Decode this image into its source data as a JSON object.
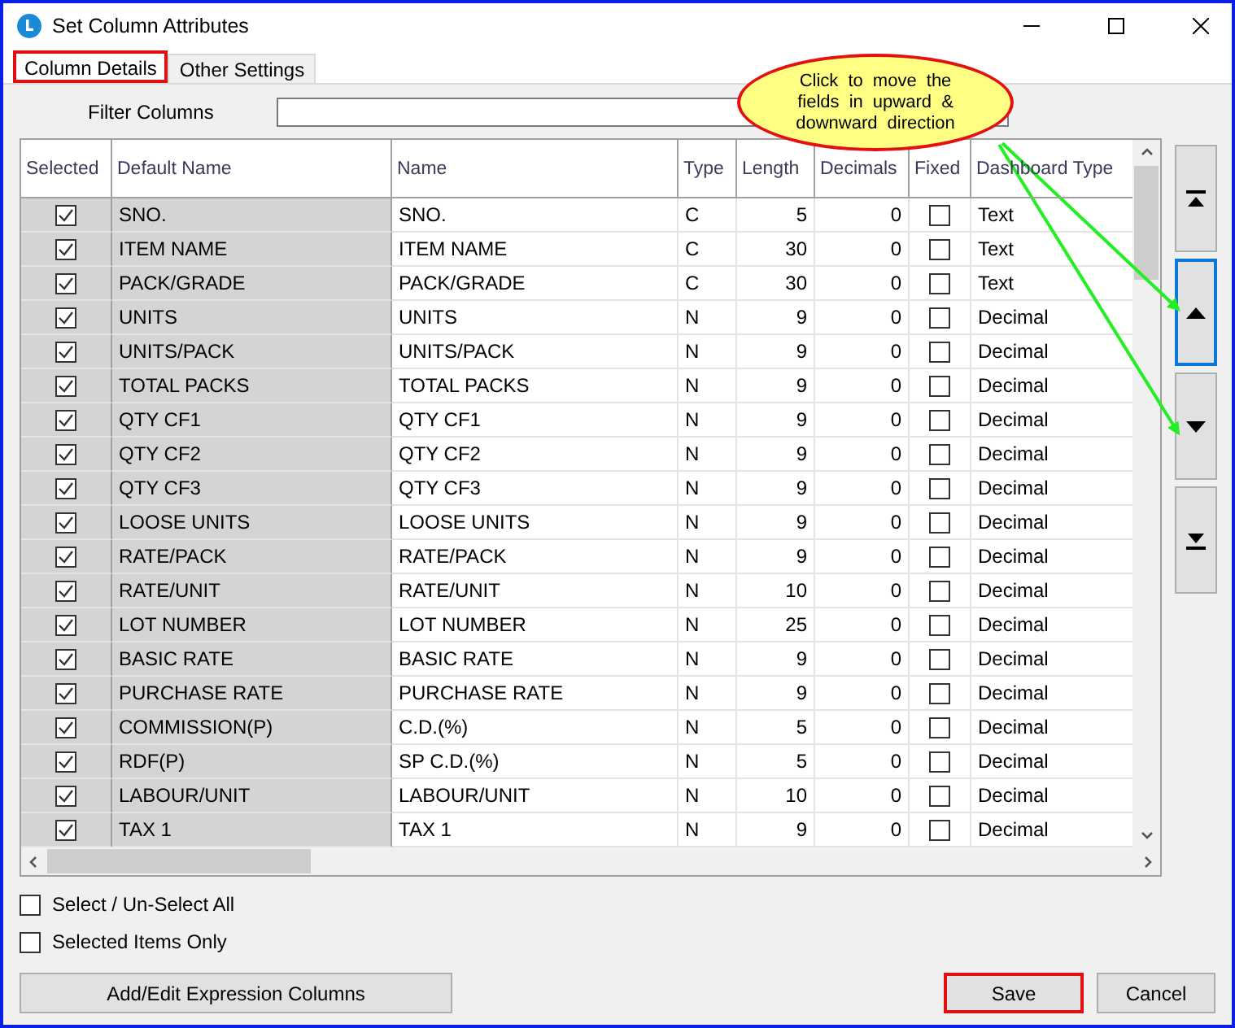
{
  "window": {
    "title": "Set Column Attributes"
  },
  "tabs": [
    {
      "label": "Column Details",
      "selected": true,
      "annotated": true
    },
    {
      "label": "Other Settings",
      "selected": false,
      "annotated": false
    }
  ],
  "filter": {
    "label": "Filter Columns"
  },
  "callout": {
    "text": "Click to move the fields in upward & downward direction"
  },
  "table": {
    "columns": [
      "Selected",
      "Default Name",
      "Name",
      "Type",
      "Length",
      "Decimals",
      "Fixed",
      "Dashboard Type"
    ],
    "rows": [
      {
        "selected": true,
        "default_name": "SNO.",
        "name": "SNO.",
        "type": "C",
        "length": "5",
        "decimals": "0",
        "fixed": false,
        "dashboard_type": "Text"
      },
      {
        "selected": true,
        "default_name": "ITEM NAME",
        "name": "ITEM NAME",
        "type": "C",
        "length": "30",
        "decimals": "0",
        "fixed": false,
        "dashboard_type": "Text"
      },
      {
        "selected": true,
        "default_name": "PACK/GRADE",
        "name": "PACK/GRADE",
        "type": "C",
        "length": "30",
        "decimals": "0",
        "fixed": false,
        "dashboard_type": "Text"
      },
      {
        "selected": true,
        "default_name": "UNITS",
        "name": "UNITS",
        "type": "N",
        "length": "9",
        "decimals": "0",
        "fixed": false,
        "dashboard_type": "Decimal"
      },
      {
        "selected": true,
        "default_name": "UNITS/PACK",
        "name": "UNITS/PACK",
        "type": "N",
        "length": "9",
        "decimals": "0",
        "fixed": false,
        "dashboard_type": "Decimal"
      },
      {
        "selected": true,
        "default_name": "TOTAL PACKS",
        "name": "TOTAL PACKS",
        "type": "N",
        "length": "9",
        "decimals": "0",
        "fixed": false,
        "dashboard_type": "Decimal"
      },
      {
        "selected": true,
        "default_name": "QTY CF1",
        "name": "QTY CF1",
        "type": "N",
        "length": "9",
        "decimals": "0",
        "fixed": false,
        "dashboard_type": "Decimal"
      },
      {
        "selected": true,
        "default_name": "QTY CF2",
        "name": "QTY CF2",
        "type": "N",
        "length": "9",
        "decimals": "0",
        "fixed": false,
        "dashboard_type": "Decimal"
      },
      {
        "selected": true,
        "default_name": "QTY CF3",
        "name": "QTY CF3",
        "type": "N",
        "length": "9",
        "decimals": "0",
        "fixed": false,
        "dashboard_type": "Decimal"
      },
      {
        "selected": true,
        "default_name": "LOOSE UNITS",
        "name": "LOOSE UNITS",
        "type": "N",
        "length": "9",
        "decimals": "0",
        "fixed": false,
        "dashboard_type": "Decimal"
      },
      {
        "selected": true,
        "default_name": "RATE/PACK",
        "name": "RATE/PACK",
        "type": "N",
        "length": "9",
        "decimals": "0",
        "fixed": false,
        "dashboard_type": "Decimal"
      },
      {
        "selected": true,
        "default_name": "RATE/UNIT",
        "name": "RATE/UNIT",
        "type": "N",
        "length": "10",
        "decimals": "0",
        "fixed": false,
        "dashboard_type": "Decimal"
      },
      {
        "selected": true,
        "default_name": "LOT NUMBER",
        "name": "LOT NUMBER",
        "type": "N",
        "length": "25",
        "decimals": "0",
        "fixed": false,
        "dashboard_type": "Decimal"
      },
      {
        "selected": true,
        "default_name": "BASIC RATE",
        "name": "BASIC RATE",
        "type": "N",
        "length": "9",
        "decimals": "0",
        "fixed": false,
        "dashboard_type": "Decimal"
      },
      {
        "selected": true,
        "default_name": "PURCHASE RATE",
        "name": "PURCHASE RATE",
        "type": "N",
        "length": "9",
        "decimals": "0",
        "fixed": false,
        "dashboard_type": "Decimal"
      },
      {
        "selected": true,
        "default_name": "COMMISSION(P)",
        "name": "C.D.(%)",
        "type": "N",
        "length": "5",
        "decimals": "0",
        "fixed": false,
        "dashboard_type": "Decimal"
      },
      {
        "selected": true,
        "default_name": "RDF(P)",
        "name": "SP C.D.(%)",
        "type": "N",
        "length": "5",
        "decimals": "0",
        "fixed": false,
        "dashboard_type": "Decimal"
      },
      {
        "selected": true,
        "default_name": "LABOUR/UNIT",
        "name": "LABOUR/UNIT",
        "type": "N",
        "length": "10",
        "decimals": "0",
        "fixed": false,
        "dashboard_type": "Decimal"
      },
      {
        "selected": true,
        "default_name": "TAX 1",
        "name": "TAX 1",
        "type": "N",
        "length": "9",
        "decimals": "0",
        "fixed": false,
        "dashboard_type": "Decimal"
      }
    ]
  },
  "move_buttons": [
    {
      "kind": "top",
      "focused": false
    },
    {
      "kind": "up",
      "focused": true
    },
    {
      "kind": "down",
      "focused": false
    },
    {
      "kind": "bottom",
      "focused": false
    }
  ],
  "options": [
    {
      "label": "Select / Un-Select All",
      "checked": false
    },
    {
      "label": "Selected Items Only",
      "checked": false
    }
  ],
  "buttons": [
    {
      "label": "Add/Edit Expression Columns",
      "annotated": false
    },
    {
      "label": "Save",
      "annotated": true
    },
    {
      "label": "Cancel",
      "annotated": false
    }
  ]
}
